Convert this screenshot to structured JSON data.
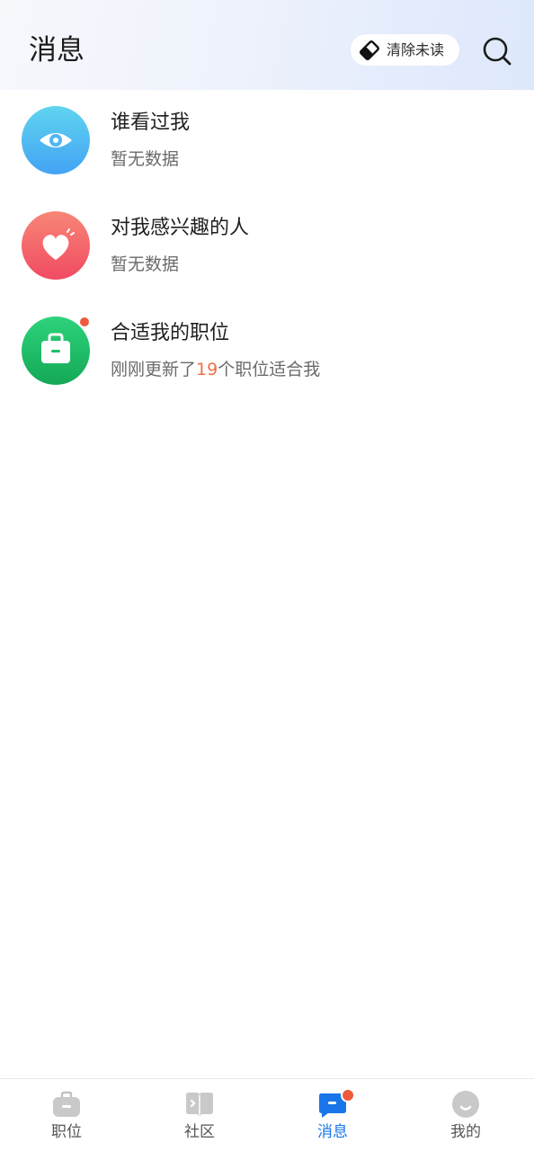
{
  "header": {
    "title": "消息",
    "clear_unread_label": "清除未读",
    "clear_unread_icon": "eraser-icon",
    "search_icon": "search-icon"
  },
  "messages": [
    {
      "title": "谁看过我",
      "subtitle": "暂无数据",
      "icon": "eye-icon",
      "color": "#4fb6f2",
      "unread": false
    },
    {
      "title": "对我感兴趣的人",
      "subtitle": "暂无数据",
      "icon": "heart-icon",
      "color": "#f2586a",
      "unread": false
    },
    {
      "title": "合适我的职位",
      "subtitle_prefix": "刚刚更新了",
      "subtitle_count": "19",
      "subtitle_suffix": "个职位适合我",
      "icon": "briefcase-icon",
      "color": "#1fbf6a",
      "unread": true
    }
  ],
  "tabbar": {
    "active": "消息",
    "tabs": [
      {
        "label": "职位",
        "icon": "briefcase-icon",
        "badge": false
      },
      {
        "label": "社区",
        "icon": "book-icon",
        "badge": false
      },
      {
        "label": "消息",
        "icon": "message-icon",
        "badge": true
      },
      {
        "label": "我的",
        "icon": "profile-icon",
        "badge": false
      }
    ]
  },
  "colors": {
    "accent": "#1976e8",
    "badge": "#ee5a3c",
    "highlight_number": "#ee7047"
  }
}
